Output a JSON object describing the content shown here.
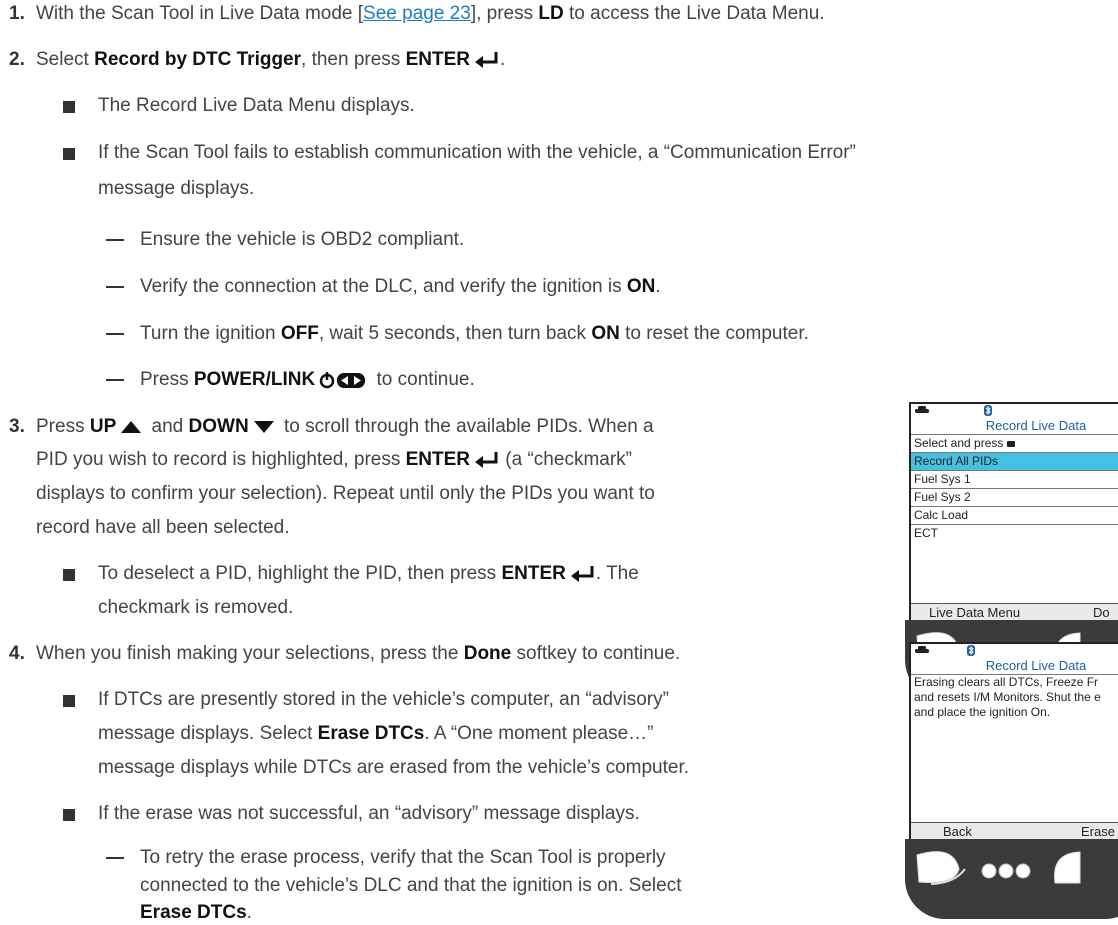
{
  "step1": {
    "num": "1.",
    "pre": "With the Scan Tool in Live Data mode [",
    "link": "See page 23",
    "mid": "], press ",
    "bold": "LD",
    "post": " to access the Live Data Menu."
  },
  "step2": {
    "num": "2.",
    "pre": "Select ",
    "bold1": "Record by DTC Trigger",
    "mid": ", then press ",
    "bold2": "ENTER",
    "post": "."
  },
  "b1": "The Record Live Data Menu displays.",
  "b2": {
    "line1": "If the Scan Tool fails to establish communication with the vehicle, a “Communication Error”",
    "line2": "message displays."
  },
  "d1": "Ensure the vehicle is OBD2 compliant.",
  "d2": {
    "pre": "Verify the connection at the DLC, and verify the ignition is ",
    "bold": "ON",
    "post": "."
  },
  "d3": {
    "pre": "Turn the ignition ",
    "bold1": "OFF",
    "mid": ", wait 5 seconds, then turn back ",
    "bold2": "ON",
    "post": " to reset the computer."
  },
  "d4": {
    "pre": "Press ",
    "bold": "POWER/LINK",
    "post": " to continue."
  },
  "step3": {
    "num": "3.",
    "l1a": "Press ",
    "l1b": "UP",
    "l1c": " and ",
    "l1d": "DOWN",
    "l1e": " to scroll through the available PIDs. When a",
    "l2a": "PID you wish to record is highlighted, press ",
    "l2b": "ENTER",
    "l2c": " (a “checkmark”",
    "l3": "displays to confirm your selection). Repeat until only the PIDs you want to",
    "l4": "record have all been selected."
  },
  "b3": {
    "l1a": "To deselect a PID, highlight the PID, then press ",
    "l1b": "ENTER",
    "l1c": ". The",
    "l2": "checkmark is removed."
  },
  "step4": {
    "num": "4.",
    "pre": "When you finish making your selections, press the ",
    "bold": "Done",
    "post": " softkey to continue."
  },
  "b4": {
    "l1": "If DTCs are presently stored in the vehicle’s computer, an “advisory”",
    "l2a": "message displays. Select ",
    "l2b": "Erase DTCs",
    "l2c": ". A “One moment please…”",
    "l3": "message displays while DTCs are erased from the vehicle’s computer."
  },
  "b5": "If the erase was not successful, an “advisory” message displays.",
  "d5": {
    "l1": "To retry the erase process, verify that the Scan Tool is properly",
    "l2": "connected to the vehicle’s DLC and that the ignition is on. Select",
    "l3": "Erase DTCs",
    "l3post": "."
  },
  "screen1": {
    "title": "Record Live Data",
    "rows": [
      "Select and press",
      "Record All PIDs",
      "Fuel Sys 1",
      "Fuel Sys 2",
      "Calc Load",
      "ECT"
    ],
    "left_key": "Live Data Menu",
    "right_key": "Do"
  },
  "screen2": {
    "title": "Record Live Data",
    "lines": [
      "Erasing clears all DTCs, Freeze Fr",
      "and resets I/M Monitors. Shut the e",
      "and place the ignition On."
    ],
    "left_key": "Back",
    "right_key": "Erase"
  },
  "colors": {
    "link": "#1a7fc0",
    "highlight": "#46c0e3",
    "screen_title": "#1d5fa3"
  }
}
